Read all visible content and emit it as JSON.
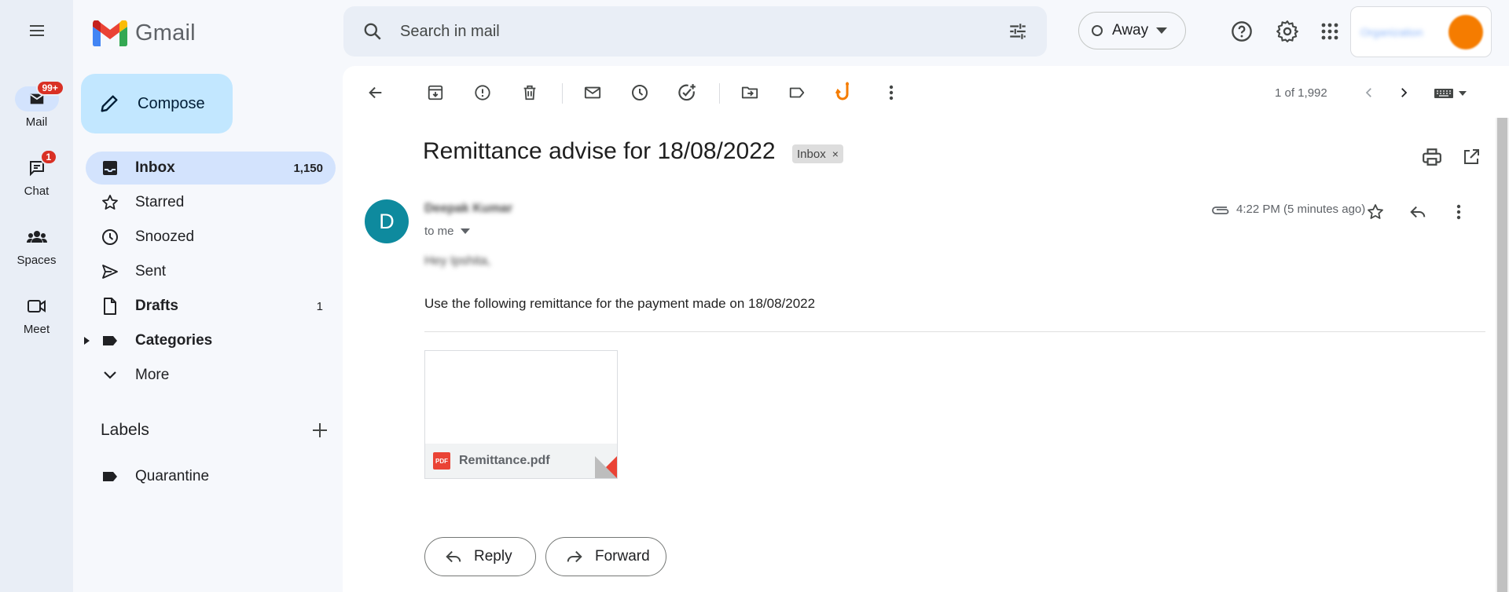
{
  "app": {
    "name": "Gmail"
  },
  "rail": {
    "items": [
      {
        "label": "Mail",
        "badge": "99+",
        "icon": "mail-icon"
      },
      {
        "label": "Chat",
        "badge": "1",
        "icon": "chat-icon"
      },
      {
        "label": "Spaces",
        "icon": "spaces-icon"
      },
      {
        "label": "Meet",
        "icon": "meet-icon"
      }
    ]
  },
  "search": {
    "placeholder": "Search in mail"
  },
  "status": {
    "label": "Away"
  },
  "account": {
    "org_text": "Organization"
  },
  "compose": {
    "label": "Compose"
  },
  "nav": {
    "items": [
      {
        "label": "Inbox",
        "count": "1,150",
        "icon": "inbox-icon"
      },
      {
        "label": "Starred",
        "count": "",
        "icon": "star-icon"
      },
      {
        "label": "Snoozed",
        "count": "",
        "icon": "clock-icon"
      },
      {
        "label": "Sent",
        "count": "",
        "icon": "send-icon"
      },
      {
        "label": "Drafts",
        "count": "1",
        "icon": "draft-icon"
      },
      {
        "label": "Categories",
        "count": "",
        "icon": "label-icon"
      },
      {
        "label": "More",
        "count": "",
        "icon": "chevron-down-icon"
      }
    ]
  },
  "labels": {
    "title": "Labels",
    "items": [
      {
        "label": "Quarantine",
        "icon": "label-icon"
      }
    ]
  },
  "toolbar": {
    "pager": "1 of 1,992"
  },
  "message": {
    "subject": "Remittance advise for 18/08/2022",
    "tag": "Inbox",
    "sender_initial": "D",
    "sender_name": "Deepak Kumar",
    "to": "to me",
    "time": "4:22 PM (5 minutes ago)",
    "greeting": "Hey Ipshita,",
    "body": "Use the following remittance for the payment made on 18/08/2022",
    "attachment": {
      "name": "Remittance.pdf",
      "type_label": "PDF"
    }
  },
  "actions": {
    "reply": "Reply",
    "forward": "Forward"
  },
  "colors": {
    "accent": "#0b57d0",
    "compose_bg": "#c2e7ff",
    "nav_active": "#d3e3fd",
    "badge": "#d93025",
    "avatar": "#0e8a9e",
    "hook": "#f57c00"
  }
}
